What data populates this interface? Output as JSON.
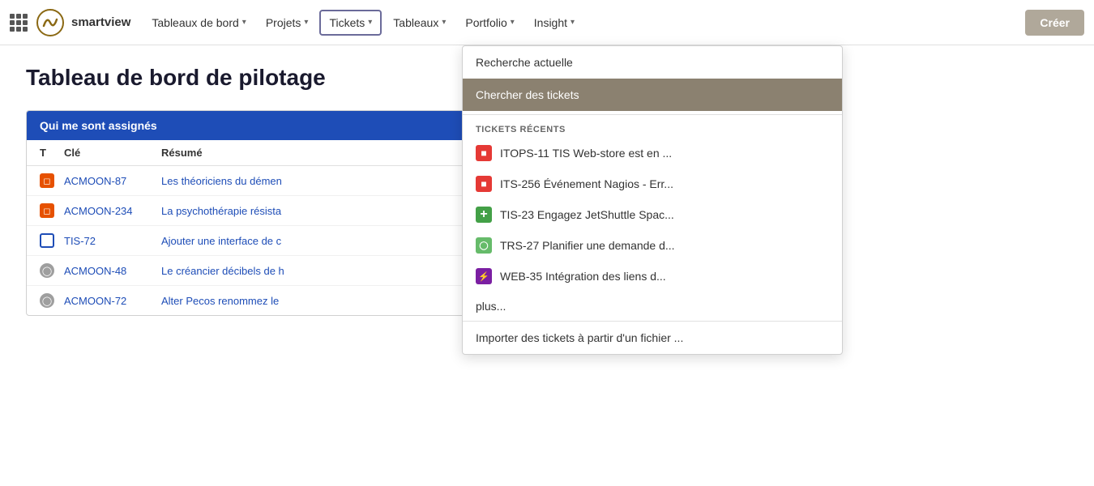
{
  "navbar": {
    "logo_text": "smartview",
    "items": [
      {
        "label": "Tableaux de bord",
        "key": "tableaux-de-bord"
      },
      {
        "label": "Projets",
        "key": "projets"
      },
      {
        "label": "Tickets",
        "key": "tickets",
        "active": true
      },
      {
        "label": "Tableaux",
        "key": "tableaux"
      },
      {
        "label": "Portfolio",
        "key": "portfolio"
      },
      {
        "label": "Insight",
        "key": "insight"
      }
    ],
    "create_label": "Créer"
  },
  "dropdown": {
    "item1": "Recherche actuelle",
    "item2": "Chercher des tickets",
    "section_label": "TICKETS RÉCENTS",
    "tickets": [
      {
        "icon_type": "red",
        "icon_letter": "■",
        "text": "ITOPS-11 TIS Web-store est en ..."
      },
      {
        "icon_type": "red",
        "icon_letter": "■",
        "text": "ITS-256 Événement Nagios - Err..."
      },
      {
        "icon_type": "green",
        "icon_letter": "+",
        "text": "TIS-23 Engagez JetShuttle Spac..."
      },
      {
        "icon_type": "light-green",
        "icon_letter": "◯",
        "text": "TRS-27 Planifier une demande d..."
      },
      {
        "icon_type": "purple",
        "icon_letter": "⚡",
        "text": "WEB-35 Intégration des liens d..."
      }
    ],
    "more_label": "plus...",
    "import_label": "Importer des tickets à partir d'un fichier ..."
  },
  "page": {
    "title": "Tableau de bord de pilotage",
    "table_header": "Qui me sont assignés",
    "columns": [
      "T",
      "Clé",
      "Résumé"
    ],
    "rows": [
      {
        "icon": "orange",
        "key": "ACMOON-87",
        "summary": "Les théoriciens du démen"
      },
      {
        "icon": "orange",
        "key": "ACMOON-234",
        "summary": "La psychothérapie résista"
      },
      {
        "icon": "blue-outline",
        "key": "TIS-72",
        "summary": "Ajouter une interface de c"
      },
      {
        "icon": "gray",
        "key": "ACMOON-48",
        "summary": "Le créancier décibels de h"
      },
      {
        "icon": "gray",
        "key": "ACMOON-72",
        "summary": "Alter Pecos renommez le"
      }
    ]
  }
}
